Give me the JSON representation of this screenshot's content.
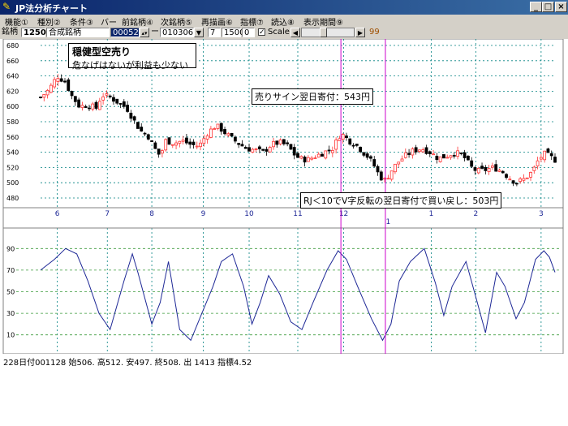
{
  "window": {
    "title": "JP法分析チャート",
    "minimize": "_",
    "maximize": "□",
    "close": "×"
  },
  "menu": [
    "機能①",
    "種別②",
    "条件③",
    "バー",
    "前銘柄④",
    "次銘柄⑤",
    "再描画⑥",
    "指標⑦",
    "読込⑧",
    "表示期間⑨"
  ],
  "toolbar": {
    "code_label": "銘柄",
    "code": "1250",
    "name": "合成銘柄",
    "price": "000524",
    "dash": "ー",
    "date": "010306",
    "param1": "7",
    "param2": "1500",
    "param3": "0",
    "scale_checked": "✓",
    "scale_label": "Scale",
    "slider_value": "99"
  },
  "annotations": {
    "strategy_title": "穏健型空売り",
    "strategy_note": "危なげはないが利益も少ない",
    "sell_signal": "売りサイン翌日寄付：543円",
    "buyback": "RJ＜10でV字反転の翌日寄付で買い戻し：503円"
  },
  "status": {
    "text": "228日付001128 始506. 高512. 安497. 終508. 出 1413 指標4.52"
  },
  "colors": {
    "up_candle": "#ff3333",
    "down_candle": "#000000",
    "grid": "#008080",
    "indicator_line": "#1e2896",
    "indicator_grid": "#3a9a3a",
    "signal_line": "#cc00cc"
  },
  "chart_data": [
    {
      "type": "candlestick",
      "title": "",
      "ylim": [
        480,
        680
      ],
      "y_ticks": [
        480,
        500,
        520,
        540,
        560,
        580,
        600,
        620,
        640,
        660,
        680
      ],
      "x_ticks": [
        "6",
        "7",
        "8",
        "9",
        "10",
        "11",
        "12",
        "1",
        "2",
        "3"
      ],
      "year_tick": "1",
      "close_path": [
        [
          0,
          612
        ],
        [
          6,
          622
        ],
        [
          12,
          640
        ],
        [
          18,
          632
        ],
        [
          22,
          615
        ],
        [
          28,
          600
        ],
        [
          34,
          602
        ],
        [
          40,
          598
        ],
        [
          44,
          615
        ],
        [
          50,
          612
        ],
        [
          56,
          605
        ],
        [
          62,
          598
        ],
        [
          66,
          585
        ],
        [
          72,
          568
        ],
        [
          78,
          560
        ],
        [
          82,
          545
        ],
        [
          86,
          535
        ],
        [
          90,
          555
        ],
        [
          96,
          552
        ],
        [
          102,
          555
        ],
        [
          108,
          550
        ],
        [
          114,
          548
        ],
        [
          120,
          565
        ],
        [
          126,
          575
        ],
        [
          130,
          570
        ],
        [
          136,
          560
        ],
        [
          142,
          552
        ],
        [
          148,
          545
        ],
        [
          154,
          543
        ],
        [
          160,
          540
        ],
        [
          166,
          550
        ],
        [
          172,
          553
        ],
        [
          178,
          548
        ],
        [
          182,
          538
        ],
        [
          186,
          532
        ],
        [
          192,
          530
        ],
        [
          198,
          535
        ],
        [
          204,
          540
        ],
        [
          210,
          545
        ],
        [
          216,
          565
        ],
        [
          222,
          555
        ],
        [
          228,
          548
        ],
        [
          232,
          540
        ],
        [
          236,
          533
        ],
        [
          240,
          522
        ],
        [
          244,
          508
        ],
        [
          248,
          503
        ],
        [
          252,
          515
        ],
        [
          256,
          525
        ],
        [
          262,
          535
        ],
        [
          268,
          542
        ],
        [
          274,
          545
        ],
        [
          280,
          540
        ],
        [
          286,
          532
        ],
        [
          292,
          535
        ],
        [
          298,
          540
        ],
        [
          304,
          535
        ],
        [
          310,
          520
        ],
        [
          314,
          515
        ],
        [
          320,
          517
        ],
        [
          326,
          520
        ],
        [
          332,
          515
        ],
        [
          336,
          508
        ],
        [
          342,
          500
        ],
        [
          348,
          505
        ],
        [
          354,
          515
        ],
        [
          358,
          530
        ],
        [
          362,
          538
        ],
        [
          366,
          535
        ],
        [
          370,
          530
        ]
      ],
      "signals": [
        {
          "name": "sell",
          "x_index": 216
        },
        {
          "name": "buyback",
          "x_index": 248
        }
      ]
    },
    {
      "type": "line",
      "title": "",
      "ylim": [
        0,
        100
      ],
      "y_ticks": [
        10,
        30,
        50,
        70,
        90
      ],
      "values": [
        [
          0,
          70
        ],
        [
          10,
          80
        ],
        [
          18,
          90
        ],
        [
          26,
          85
        ],
        [
          34,
          60
        ],
        [
          42,
          30
        ],
        [
          50,
          15
        ],
        [
          60,
          60
        ],
        [
          66,
          85
        ],
        [
          70,
          68
        ],
        [
          80,
          20
        ],
        [
          86,
          40
        ],
        [
          92,
          78
        ],
        [
          100,
          15
        ],
        [
          108,
          5
        ],
        [
          116,
          30
        ],
        [
          124,
          55
        ],
        [
          130,
          78
        ],
        [
          138,
          85
        ],
        [
          146,
          55
        ],
        [
          152,
          20
        ],
        [
          158,
          40
        ],
        [
          164,
          65
        ],
        [
          172,
          48
        ],
        [
          180,
          22
        ],
        [
          188,
          15
        ],
        [
          196,
          40
        ],
        [
          206,
          70
        ],
        [
          214,
          88
        ],
        [
          220,
          80
        ],
        [
          228,
          55
        ],
        [
          238,
          25
        ],
        [
          246,
          5
        ],
        [
          252,
          20
        ],
        [
          258,
          60
        ],
        [
          266,
          78
        ],
        [
          276,
          90
        ],
        [
          284,
          58
        ],
        [
          290,
          28
        ],
        [
          296,
          55
        ],
        [
          306,
          78
        ],
        [
          312,
          50
        ],
        [
          320,
          12
        ],
        [
          328,
          68
        ],
        [
          334,
          55
        ],
        [
          342,
          25
        ],
        [
          348,
          40
        ],
        [
          356,
          80
        ],
        [
          362,
          88
        ],
        [
          366,
          82
        ],
        [
          370,
          68
        ]
      ]
    }
  ]
}
